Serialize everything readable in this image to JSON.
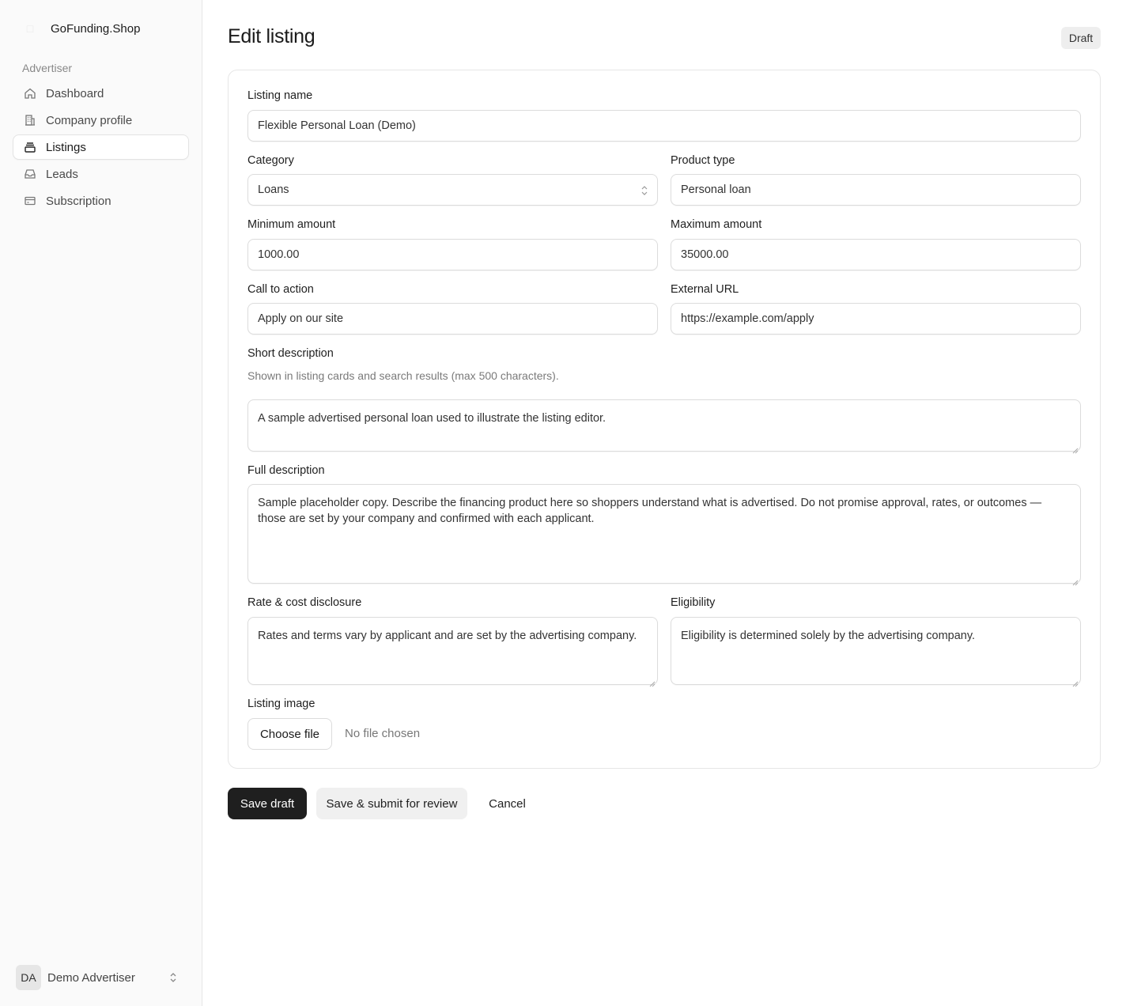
{
  "app": {
    "brand_name": "GoFunding.Shop",
    "section_label": "Advertiser"
  },
  "sidebar": {
    "items": [
      {
        "label": "Dashboard",
        "icon": "home-icon",
        "active": false
      },
      {
        "label": "Company profile",
        "icon": "building-icon",
        "active": false
      },
      {
        "label": "Listings",
        "icon": "listings-icon",
        "active": true
      },
      {
        "label": "Leads",
        "icon": "inbox-icon",
        "active": false
      },
      {
        "label": "Subscription",
        "icon": "credit-card-icon",
        "active": false
      }
    ]
  },
  "user": {
    "initials": "DA",
    "name": "Demo Advertiser"
  },
  "header": {
    "title": "Edit listing",
    "status": "Draft"
  },
  "form": {
    "listing_name": {
      "label": "Listing name",
      "value": "Flexible Personal Loan (Demo)"
    },
    "category": {
      "label": "Category",
      "value": "Loans"
    },
    "product_type": {
      "label": "Product type",
      "value": "Personal loan"
    },
    "min_amount": {
      "label": "Minimum amount",
      "value": "1000.00"
    },
    "max_amount": {
      "label": "Maximum amount",
      "value": "35000.00"
    },
    "call_to_action": {
      "label": "Call to action",
      "value": "Apply on our site"
    },
    "external_url": {
      "label": "External URL",
      "value": "https://example.com/apply"
    },
    "short_description": {
      "label": "Short description",
      "hint": "Shown in listing cards and search results (max 500 characters).",
      "value": "A sample advertised personal loan used to illustrate the listing editor."
    },
    "full_description": {
      "label": "Full description",
      "value": "Sample placeholder copy. Describe the financing product here so shoppers understand what is advertised. Do not promise approval, rates, or outcomes — those are set by your company and confirmed with each applicant."
    },
    "rate_disclosure": {
      "label": "Rate & cost disclosure",
      "value": "Rates and terms vary by applicant and are set by the advertising company."
    },
    "eligibility": {
      "label": "Eligibility",
      "value": "Eligibility is determined solely by the advertising company."
    },
    "listing_image": {
      "label": "Listing image",
      "button": "Choose file",
      "status": "No file chosen"
    }
  },
  "actions": {
    "save_draft": "Save draft",
    "submit_review": "Save & submit for review",
    "cancel": "Cancel"
  }
}
